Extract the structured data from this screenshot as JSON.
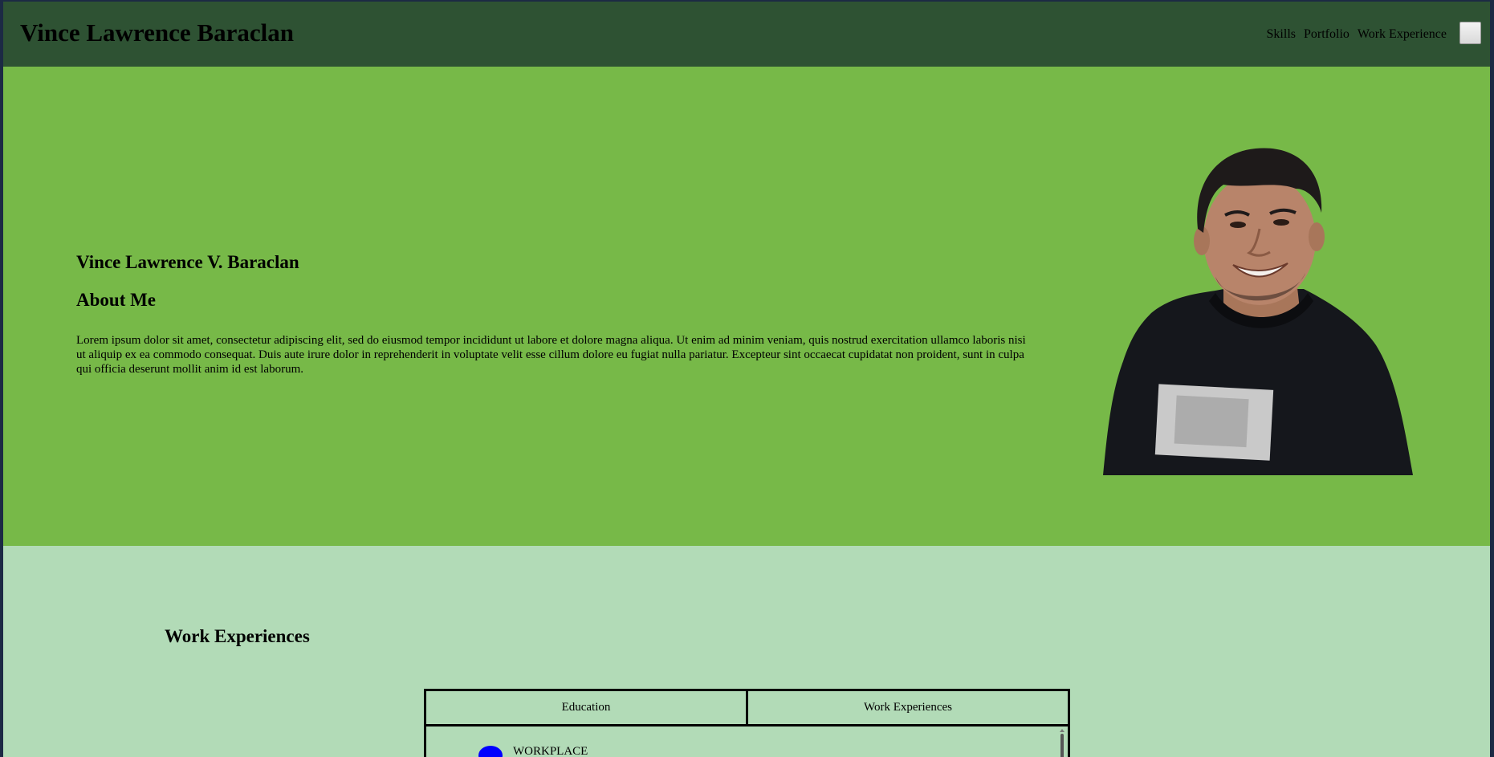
{
  "header": {
    "brand": "Vince Lawrence Baraclan",
    "nav": [
      "Skills",
      "Portfolio",
      "Work Experience"
    ]
  },
  "hero": {
    "name": "Vince Lawrence V. Baraclan",
    "about_heading": "About Me",
    "about_text": "Lorem ipsum dolor sit amet, consectetur adipiscing elit, sed do eiusmod tempor incididunt ut labore et dolore magna aliqua. Ut enim ad minim veniam, quis nostrud exercitation ullamco laboris nisi ut aliquip ex ea commodo consequat. Duis aute irure dolor in reprehenderit in voluptate velit esse cillum dolore eu fugiat nulla pariatur. Excepteur sint occaecat cupidatat non proident, sunt in culpa qui officia deserunt mollit anim id est laborum."
  },
  "work": {
    "heading": "Work Experiences",
    "tabs": [
      "Education",
      "Work Experiences"
    ],
    "entry_title": "WORKPLACE"
  },
  "colors": {
    "navbar": "#2e5233",
    "hero_bg": "#77b948",
    "work_bg": "#b2dbb7",
    "timeline_dot": "#0000ff"
  }
}
